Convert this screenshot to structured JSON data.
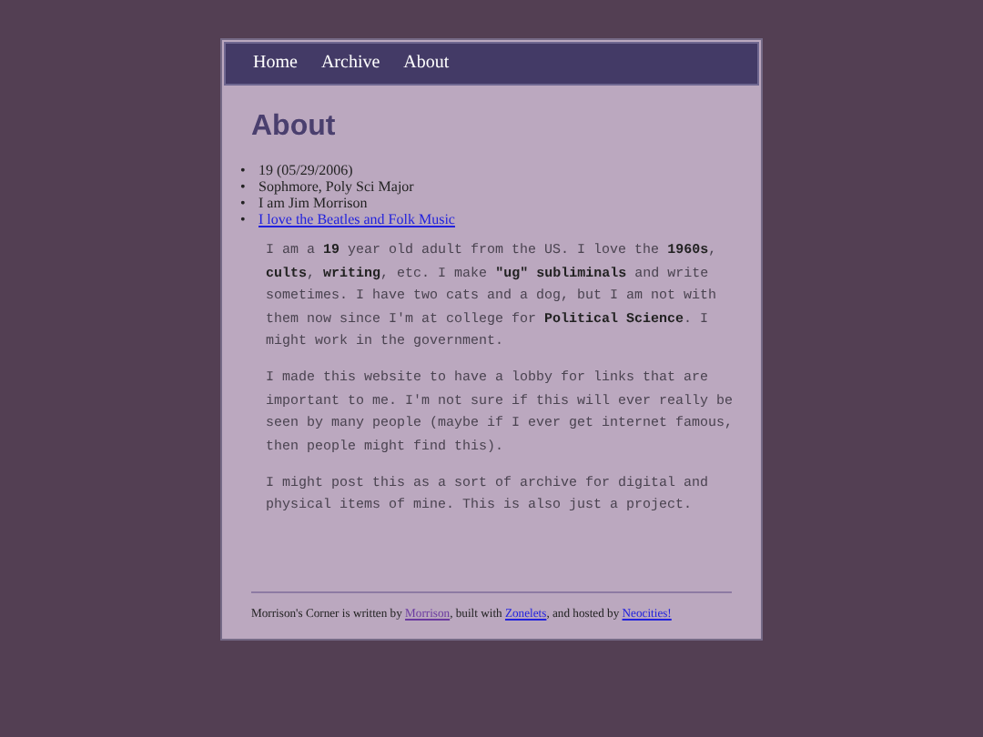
{
  "nav": {
    "items": [
      {
        "label": "Home"
      },
      {
        "label": "Archive"
      },
      {
        "label": "About"
      }
    ]
  },
  "page": {
    "title": "About",
    "facts": [
      {
        "kind": "text",
        "bullet": "•",
        "text": "19 (05/29/2006)"
      },
      {
        "kind": "text",
        "bullet": "•",
        "text": "Sophmore, Poly Sci Major"
      },
      {
        "kind": "text",
        "bullet": "•",
        "text": "I am Jim Morrison"
      },
      {
        "kind": "link",
        "bullet": "•",
        "text": "I love the Beatles and Folk Music"
      }
    ],
    "paragraphs": [
      "I am a **19** year old adult from the US. I love the **1960s**, **cults**, **writing**, etc. I make **\"ug\" subliminals** and write sometimes. I have two cats and a dog, but I am not with them now since I'm at college for **Political Science**. I might work in the government.",
      "I made this website to have a lobby for links that are important to me. I'm not sure if this will ever really be seen by many people (maybe if I ever get internet famous, then people might find this).",
      "I might post this as a sort of archive for digital and physical items of mine. This is also just a project."
    ]
  },
  "footer": {
    "segments": [
      {
        "kind": "text",
        "text": "Morrison's Corner is written by "
      },
      {
        "kind": "link",
        "text": "Morrison",
        "visited": true
      },
      {
        "kind": "text",
        "text": ", built with "
      },
      {
        "kind": "link",
        "text": "Zonelets",
        "visited": false
      },
      {
        "kind": "text",
        "text": ", and hosted by "
      },
      {
        "kind": "link",
        "text": "Neocities!",
        "visited": false
      }
    ]
  }
}
